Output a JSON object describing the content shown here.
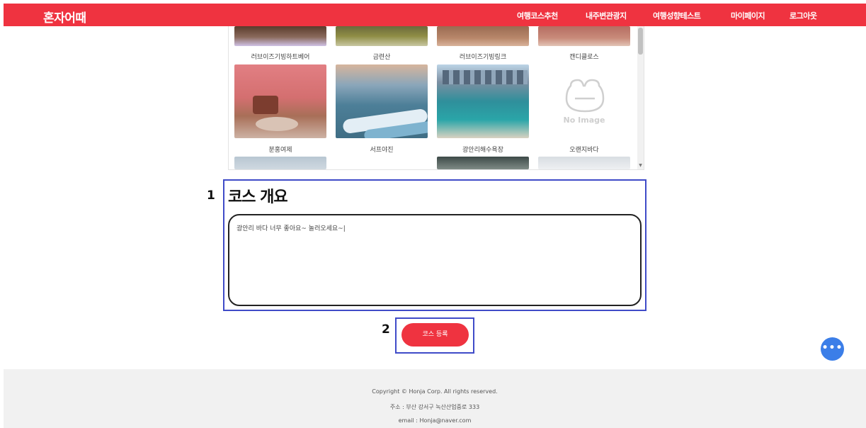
{
  "header": {
    "logo": "혼자어때",
    "nav": [
      {
        "label": "여행코스추천"
      },
      {
        "label": "내주변관광지"
      },
      {
        "label": "여행성향테스트"
      },
      {
        "label": "마이페이지"
      },
      {
        "label": "로그아웃"
      }
    ],
    "brand_color": "#ef3340"
  },
  "gallery": {
    "items": [
      {
        "name": "러브이즈기빙하트베어",
        "image": "photo"
      },
      {
        "name": "금련산",
        "image": "photo"
      },
      {
        "name": "러브이즈기빙링크",
        "image": "photo"
      },
      {
        "name": "캔디클로스",
        "image": "photo"
      },
      {
        "name": "분홍여제",
        "image": "photo"
      },
      {
        "name": "서프야진",
        "image": "photo"
      },
      {
        "name": "광안리해수욕장",
        "image": "photo"
      },
      {
        "name": "오랜지바다",
        "image": "no-image"
      }
    ],
    "no_image_label": "No Image"
  },
  "annotations": {
    "first": "1",
    "second": "2"
  },
  "overview": {
    "title": "코스 개요",
    "text": "광안리 바다 너무 좋아요~ 놀러오세요~|"
  },
  "submit": {
    "label": "코스 등록"
  },
  "chat": {
    "icon": "chat-bubble-icon"
  },
  "footer": {
    "copyright": "Copyright © Honja Corp. All rights reserved.",
    "address": "주소 : 부산 강서구 녹산산업중로 333",
    "email": "email : Honja@naver.com"
  }
}
